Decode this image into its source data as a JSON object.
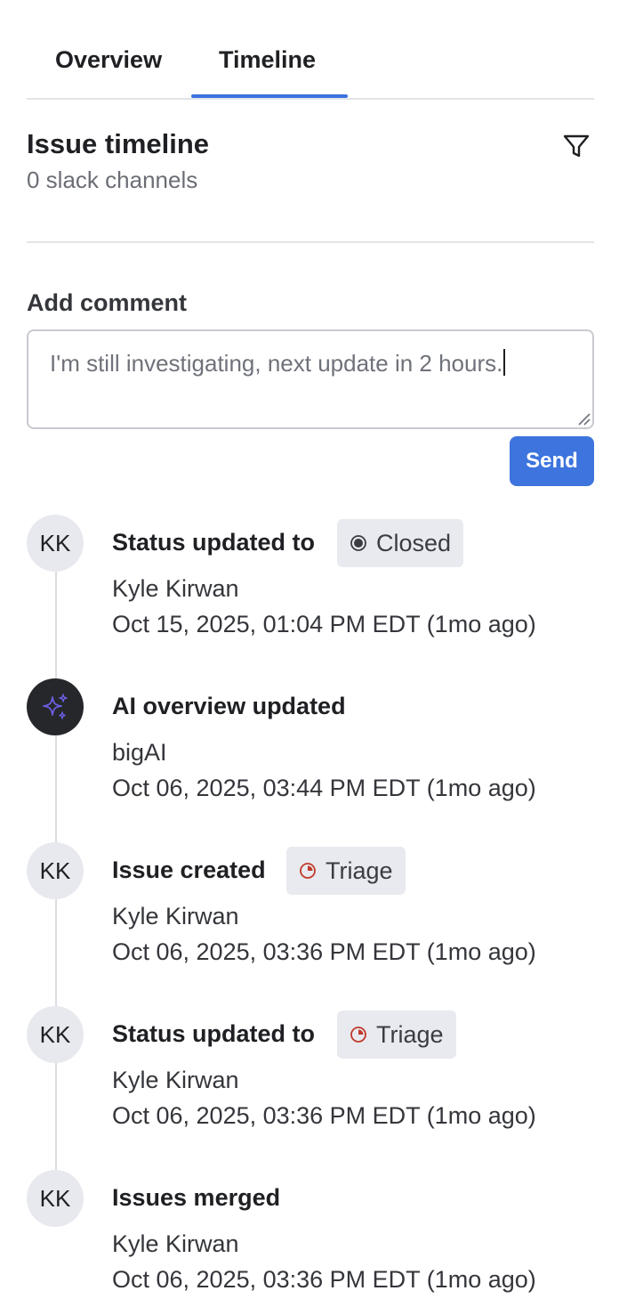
{
  "tabs": [
    {
      "label": "Overview",
      "active": false
    },
    {
      "label": "Timeline",
      "active": true
    }
  ],
  "header": {
    "title": "Issue timeline",
    "subtitle": "0 slack channels",
    "filter_icon": "filter-icon"
  },
  "comment": {
    "label": "Add comment",
    "value": "I'm still investigating, next update in 2 hours.",
    "send_label": "Send"
  },
  "colors": {
    "accent": "#3d74de",
    "triage": "#c0392b",
    "closed": "#3a3c42",
    "ai_avatar_bg": "#26272b",
    "ai_icon": "#6b5fe0"
  },
  "events": [
    {
      "avatar": "KK",
      "avatar_type": "user",
      "title": "Status updated to",
      "badge": {
        "label": "Closed",
        "icon": "closed-status-icon"
      },
      "author": "Kyle Kirwan",
      "time": "Oct 15, 2025, 01:04 PM EDT (1mo ago)"
    },
    {
      "avatar": "",
      "avatar_type": "ai",
      "avatar_icon": "sparkles-icon",
      "title": "AI overview updated",
      "author": "bigAI",
      "time": "Oct 06, 2025, 03:44 PM EDT (1mo ago)"
    },
    {
      "avatar": "KK",
      "avatar_type": "user",
      "title": "Issue created",
      "badge": {
        "label": "Triage",
        "icon": "triage-status-icon"
      },
      "author": "Kyle Kirwan",
      "time": "Oct 06, 2025, 03:36 PM EDT (1mo ago)"
    },
    {
      "avatar": "KK",
      "avatar_type": "user",
      "title": "Status updated to",
      "badge": {
        "label": "Triage",
        "icon": "triage-status-icon"
      },
      "author": "Kyle Kirwan",
      "time": "Oct 06, 2025, 03:36 PM EDT (1mo ago)"
    },
    {
      "avatar": "KK",
      "avatar_type": "user",
      "title": "Issues merged",
      "author": "Kyle Kirwan",
      "time": "Oct 06, 2025, 03:36 PM EDT (1mo ago)"
    }
  ]
}
